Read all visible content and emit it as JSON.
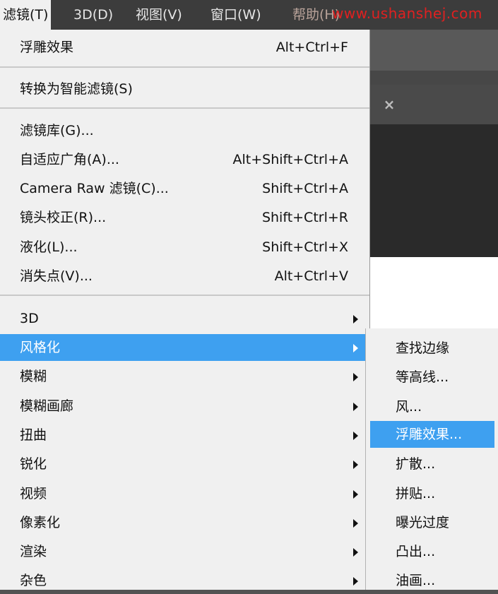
{
  "menubar": {
    "items": [
      {
        "label": "滤镜(T)"
      },
      {
        "label": "3D(D)"
      },
      {
        "label": "视图(V)"
      },
      {
        "label": "窗口(W)"
      },
      {
        "label": "帮助(H)"
      }
    ],
    "watermark": "www.ushanshej.com"
  },
  "background": {
    "tab_close_glyph": "×"
  },
  "filter_menu": {
    "last_filter": {
      "label": "浮雕效果",
      "shortcut": "Alt+Ctrl+F"
    },
    "convert_smart": {
      "label": "转换为智能滤镜(S)"
    },
    "gallery": {
      "label": "滤镜库(G)..."
    },
    "adaptive_wide": {
      "label": "自适应广角(A)...",
      "shortcut": "Alt+Shift+Ctrl+A"
    },
    "camera_raw": {
      "label": "Camera Raw 滤镜(C)...",
      "shortcut": "Shift+Ctrl+A"
    },
    "lens_correction": {
      "label": "镜头校正(R)...",
      "shortcut": "Shift+Ctrl+R"
    },
    "liquify": {
      "label": "液化(L)...",
      "shortcut": "Shift+Ctrl+X"
    },
    "vanishing_point": {
      "label": "消失点(V)...",
      "shortcut": "Alt+Ctrl+V"
    },
    "submenus": [
      {
        "label": "3D"
      },
      {
        "label": "风格化"
      },
      {
        "label": "模糊"
      },
      {
        "label": "模糊画廊"
      },
      {
        "label": "扭曲"
      },
      {
        "label": "锐化"
      },
      {
        "label": "视频"
      },
      {
        "label": "像素化"
      },
      {
        "label": "渲染"
      },
      {
        "label": "杂色"
      }
    ],
    "highlighted": "风格化"
  },
  "stylize_submenu": {
    "items": [
      {
        "label": "查找边缘"
      },
      {
        "label": "等高线..."
      },
      {
        "label": "风..."
      },
      {
        "label": "浮雕效果..."
      },
      {
        "label": "扩散..."
      },
      {
        "label": "拼贴..."
      },
      {
        "label": "曝光过度"
      },
      {
        "label": "凸出..."
      },
      {
        "label": "油画..."
      }
    ],
    "highlighted": "浮雕效果...",
    "highlight_color": "#3ea0f0"
  }
}
